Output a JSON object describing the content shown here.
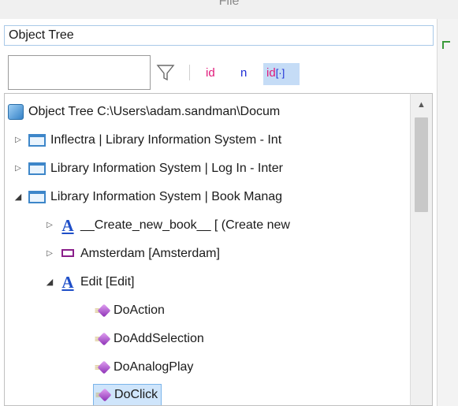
{
  "header": {
    "file_label": "File"
  },
  "panel": {
    "title": "Object Tree"
  },
  "toolbar": {
    "search_value": "",
    "search_placeholder": "",
    "filter_icon": "filter-funnel-icon",
    "id_label": "id",
    "n_label": "n",
    "id_param_label": "id",
    "id_param_bracket": "[·]"
  },
  "tree": {
    "root": {
      "label": "Object Tree C:\\Users\\adam.sandman\\Docum",
      "icon": "object-tree-icon"
    },
    "windows": [
      {
        "label": "Inflectra | Library Information System - Int",
        "expanded": false
      },
      {
        "label": "Library Information System | Log In - Inter",
        "expanded": false
      },
      {
        "label": "Library Information System | Book Manag",
        "expanded": true
      }
    ],
    "children": [
      {
        "label": "__Create_new_book__ [ (Create new",
        "icon": "text-object-icon",
        "expanded": false
      },
      {
        "label": "Amsterdam [Amsterdam]",
        "icon": "rectangle-object-icon",
        "expanded": false
      },
      {
        "label": "Edit [Edit]",
        "icon": "text-object-icon",
        "expanded": true
      }
    ],
    "methods": [
      {
        "label": "DoAction",
        "selected": false
      },
      {
        "label": "DoAddSelection",
        "selected": false
      },
      {
        "label": "DoAnalogPlay",
        "selected": false
      },
      {
        "label": "DoClick",
        "selected": true
      }
    ]
  },
  "colors": {
    "selection_bg": "#cfe5fb",
    "id_color": "#e0197a",
    "n_color": "#1e2fd6",
    "window_icon": "#3d86c9"
  }
}
